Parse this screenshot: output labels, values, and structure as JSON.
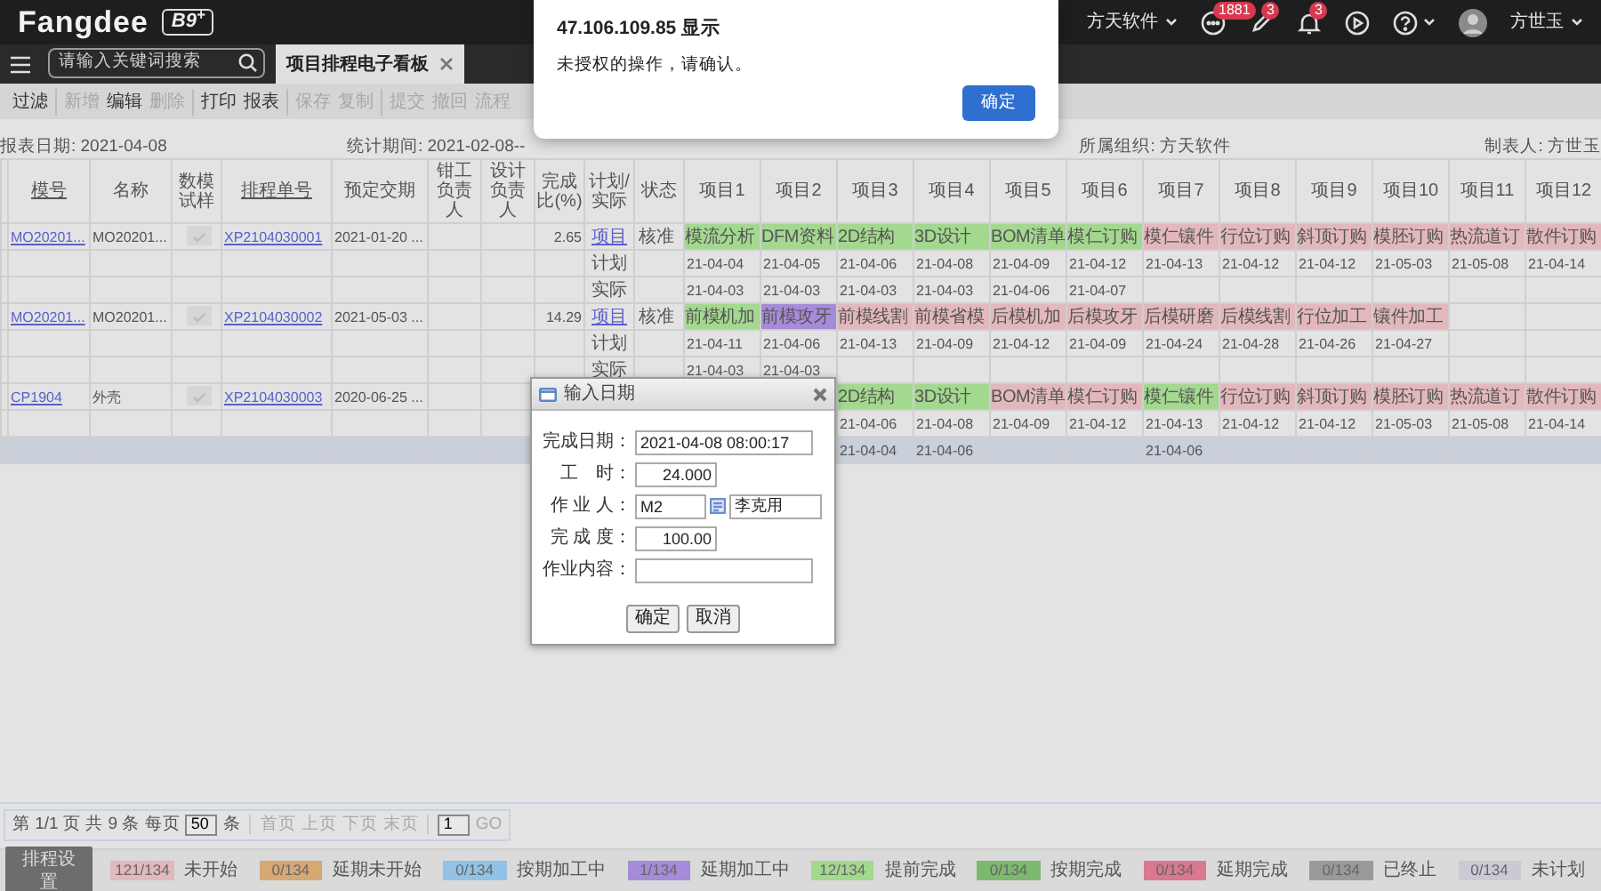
{
  "alert": {
    "title": "47.106.109.85 显示",
    "message": "未授权的操作，请确认。",
    "button": "确定"
  },
  "topbar": {
    "logo": "Fangdee",
    "edition": "B9$^{+}$",
    "company": "方天软件",
    "user": "方世玉",
    "icons": [
      {
        "kind": "chat",
        "badge": "1881"
      },
      {
        "kind": "pencil",
        "badge": "3"
      },
      {
        "kind": "bell",
        "badge": "3"
      },
      {
        "kind": "play"
      },
      {
        "kind": "help"
      }
    ]
  },
  "tabbar": {
    "search": {
      "placeholder": "请输入关键词搜索"
    },
    "tabs": [
      {
        "label": "项目排程电子看板",
        "selected": true
      }
    ]
  },
  "toolbar": [
    {
      "buttons": [
        {
          "label": "过滤",
          "disabled": false
        }
      ]
    },
    {
      "buttons": [
        {
          "label": "新增",
          "disabled": true
        },
        {
          "label": "编辑",
          "disabled": false
        },
        {
          "label": "删除",
          "disabled": true
        }
      ]
    },
    {
      "buttons": [
        {
          "label": "打印",
          "disabled": false
        },
        {
          "label": "报表",
          "disabled": false
        }
      ]
    },
    {
      "buttons": [
        {
          "label": "保存",
          "disabled": true
        },
        {
          "label": "复制",
          "disabled": true
        }
      ]
    },
    {
      "buttons": [
        {
          "label": "提交",
          "disabled": true
        },
        {
          "label": "撤回",
          "disabled": true
        },
        {
          "label": "流程",
          "disabled": true
        }
      ]
    }
  ],
  "report_info": {
    "report_date": "报表日期: 2021-04-08",
    "period": "统计期间: 2021-02-08--",
    "organization": "所属组织: 方天软件",
    "preparer": "制表人: 方世玉"
  },
  "table": {
    "columns": [
      {
        "label": "模号",
        "sortable": true
      },
      {
        "label": "名称",
        "sortable": false
      },
      {
        "label": "数模试样",
        "sortable": false
      },
      {
        "label": "排程单号",
        "sortable": true
      },
      {
        "label": "预定交期",
        "sortable": false
      },
      {
        "label": "钳工负责人",
        "sortable": false
      },
      {
        "label": "设计负责人",
        "sortable": false
      },
      {
        "label": "完成比(%)",
        "sortable": false
      },
      {
        "label": "计划/实际",
        "sortable": false
      },
      {
        "label": "状态",
        "sortable": false
      },
      {
        "label": "项目1",
        "sortable": false
      },
      {
        "label": "项目2",
        "sortable": false
      },
      {
        "label": "项目3",
        "sortable": false
      },
      {
        "label": "项目4",
        "sortable": false
      },
      {
        "label": "项目5",
        "sortable": false
      },
      {
        "label": "项目6",
        "sortable": false
      },
      {
        "label": "项目7",
        "sortable": false
      },
      {
        "label": "项目8",
        "sortable": false
      },
      {
        "label": "项目9",
        "sortable": false
      },
      {
        "label": "项目10",
        "sortable": false
      },
      {
        "label": "项目11",
        "sortable": false
      },
      {
        "label": "项目12",
        "sortable": false
      }
    ],
    "orders": [
      {
        "mold_no": "MO20201...",
        "name": "MO20201...",
        "sample_checked": true,
        "schedule_no": "XP2104030001",
        "due_date": "2021-01-20 ...",
        "completion": "2.65",
        "status": "核准",
        "rows": [
          {
            "kind": "items",
            "label": "项目",
            "selected": false,
            "cells": [
              {
                "text": "模流分析",
                "color": "#a3d88f"
              },
              {
                "text": "DFM资料",
                "color": "#a3d88f"
              },
              {
                "text": "2D结构",
                "color": "#a3d88f"
              },
              {
                "text": "3D设计",
                "color": "#a3d88f"
              },
              {
                "text": "BOM清单",
                "color": "#a3d88f"
              },
              {
                "text": "模仁订购",
                "color": "#a3d88f"
              },
              {
                "text": "模仁镶件",
                "color": "#e3b8bc"
              },
              {
                "text": "行位订购",
                "color": "#e3b8bc"
              },
              {
                "text": "斜顶订购",
                "color": "#e3b8bc"
              },
              {
                "text": "模胚订购",
                "color": "#e3b8bc"
              },
              {
                "text": "热流道订",
                "color": "#e3b8bc"
              },
              {
                "text": "散件订购",
                "color": "#e3b8bc"
              }
            ]
          },
          {
            "kind": "dates",
            "label": "计划",
            "selected": false,
            "cells": [
              "21-04-04",
              "21-04-05",
              "21-04-06",
              "21-04-08",
              "21-04-09",
              "21-04-12",
              "21-04-13",
              "21-04-12",
              "21-04-12",
              "21-05-03",
              "21-05-08",
              "21-04-14"
            ]
          },
          {
            "kind": "dates",
            "label": "实际",
            "selected": false,
            "cells": [
              "21-04-03",
              "21-04-03",
              "21-04-03",
              "21-04-03",
              "21-04-06",
              "21-04-07",
              null,
              null,
              null,
              null,
              null,
              null
            ]
          }
        ]
      },
      {
        "mold_no": "MO20201...",
        "name": "MO20201...",
        "sample_checked": true,
        "schedule_no": "XP2104030002",
        "due_date": "2021-05-03 ...",
        "completion": "14.29",
        "status": "核准",
        "rows": [
          {
            "kind": "items",
            "label": "项目",
            "selected": false,
            "cells": [
              {
                "text": "前模机加",
                "color": "#a3d88f"
              },
              {
                "text": "前模攻牙",
                "color": "#a68bd9"
              },
              {
                "text": "前模线割",
                "color": "#e3b8bc"
              },
              {
                "text": "前模省模",
                "color": "#e3b8bc"
              },
              {
                "text": "后模机加",
                "color": "#e3b8bc"
              },
              {
                "text": "后模攻牙",
                "color": "#e3b8bc"
              },
              {
                "text": "后模研磨",
                "color": "#e3b8bc"
              },
              {
                "text": "后模线割",
                "color": "#e3b8bc"
              },
              {
                "text": "行位加工",
                "color": "#e3b8bc"
              },
              {
                "text": "镶件加工",
                "color": "#e3b8bc"
              },
              null,
              null
            ]
          },
          {
            "kind": "dates",
            "label": "计划",
            "selected": false,
            "cells": [
              "21-04-11",
              "21-04-06",
              "21-04-13",
              "21-04-09",
              "21-04-12",
              "21-04-09",
              "21-04-24",
              "21-04-28",
              "21-04-26",
              "21-04-27",
              null,
              null
            ]
          },
          {
            "kind": "dates",
            "label": "实际",
            "selected": false,
            "cells": [
              "21-04-03",
              "21-04-03",
              null,
              null,
              null,
              null,
              null,
              null,
              null,
              null,
              null,
              null
            ]
          }
        ]
      },
      {
        "mold_no": "CP1904",
        "name": "外壳",
        "sample_checked": true,
        "schedule_no": "XP2104030003",
        "due_date": "2020-06-25 ...",
        "rows": [
          {
            "kind": "items",
            "selected": false,
            "cells": [
              null,
              null,
              {
                "text": "2D结构",
                "color": "#a3d88f"
              },
              {
                "text": "3D设计",
                "color": "#a3d88f"
              },
              {
                "text": "BOM清单",
                "color": "#e3b8bc"
              },
              {
                "text": "模仁订购",
                "color": "#e3b8bc"
              },
              {
                "text": "模仁镶件",
                "color": "#a3d88f"
              },
              {
                "text": "行位订购",
                "color": "#e3b8bc"
              },
              {
                "text": "斜顶订购",
                "color": "#e3b8bc"
              },
              {
                "text": "模胚订购",
                "color": "#e3b8bc"
              },
              {
                "text": "热流道订",
                "color": "#e3b8bc"
              },
              {
                "text": "散件订购",
                "color": "#e3b8bc"
              }
            ]
          },
          {
            "kind": "dates",
            "selected": false,
            "cells": [
              null,
              null,
              "21-04-06",
              "21-04-08",
              "21-04-09",
              "21-04-12",
              "21-04-13",
              "21-04-12",
              "21-04-12",
              "21-05-03",
              "21-05-08",
              "21-04-14"
            ]
          },
          {
            "kind": "dates",
            "selected": true,
            "cells": [
              null,
              null,
              "21-04-04",
              "21-04-06",
              null,
              null,
              "21-04-06",
              null,
              null,
              null,
              null,
              null
            ]
          }
        ]
      }
    ]
  },
  "dialog": {
    "title": "输入日期",
    "fields": [
      {
        "kind": "text",
        "label": "完成日期：",
        "value": "2021-04-08 08:00:17"
      },
      {
        "kind": "number",
        "label": "工　时：",
        "value": "24.000"
      },
      {
        "kind": "picker",
        "label": "作 业 人：",
        "value": "M2",
        "extra": "李克用"
      },
      {
        "kind": "number",
        "label": "完 成 度：",
        "value": "100.00"
      },
      {
        "kind": "text",
        "label": "作业内容："
      }
    ],
    "buttons": [
      "确定",
      "取消"
    ]
  },
  "pager": {
    "summary": "第 1/1 页 共 9 条 每页",
    "page_size": "50",
    "unit": "条",
    "links": [
      {
        "label": "首页",
        "disabled": true
      },
      {
        "label": "上页",
        "disabled": true
      },
      {
        "label": "下页",
        "disabled": true
      },
      {
        "label": "末页",
        "disabled": true
      }
    ],
    "page": "1",
    "go": {
      "label": "GO",
      "disabled": true
    }
  },
  "legend": {
    "button": "排程设置",
    "items": [
      {
        "count": "121/134",
        "label": "未开始",
        "color": "#e3b8bc"
      },
      {
        "count": "0/134",
        "label": "延期未开始",
        "color": "#d6a874"
      },
      {
        "count": "0/134",
        "label": "按期加工中",
        "color": "#92c2e6"
      },
      {
        "count": "1/134",
        "label": "延期加工中",
        "color": "#a68bd9"
      },
      {
        "count": "12/134",
        "label": "提前完成",
        "color": "#a3d88f"
      },
      {
        "count": "0/134",
        "label": "按期完成",
        "color": "#7cb96e"
      },
      {
        "count": "0/134",
        "label": "延期完成",
        "color": "#d9788e"
      },
      {
        "count": "0/134",
        "label": "已终止",
        "color": "#9a9a9a"
      },
      {
        "count": "0/134",
        "label": "未计划",
        "color": "#cacad6"
      }
    ]
  }
}
